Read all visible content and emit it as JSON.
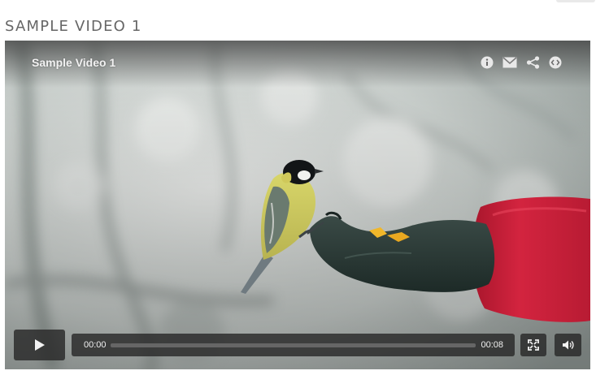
{
  "page": {
    "heading": "SAMPLE VIDEO 1"
  },
  "player": {
    "title": "Sample Video 1",
    "top_icons": [
      "info-icon",
      "email-icon",
      "share-icon",
      "embed-icon"
    ],
    "controls": {
      "current_time": "00:00",
      "duration": "00:08",
      "progress_fraction": 0,
      "play_icon": "play-icon",
      "fullscreen_icon": "fullscreen-icon",
      "volume_icon": "volume-icon"
    }
  },
  "colors": {
    "heading_text": "#666666",
    "control_bg": "#282828",
    "control_text": "#f0f0f0",
    "sleeve_red": "#c5223a",
    "glove_dark": "#263733"
  }
}
